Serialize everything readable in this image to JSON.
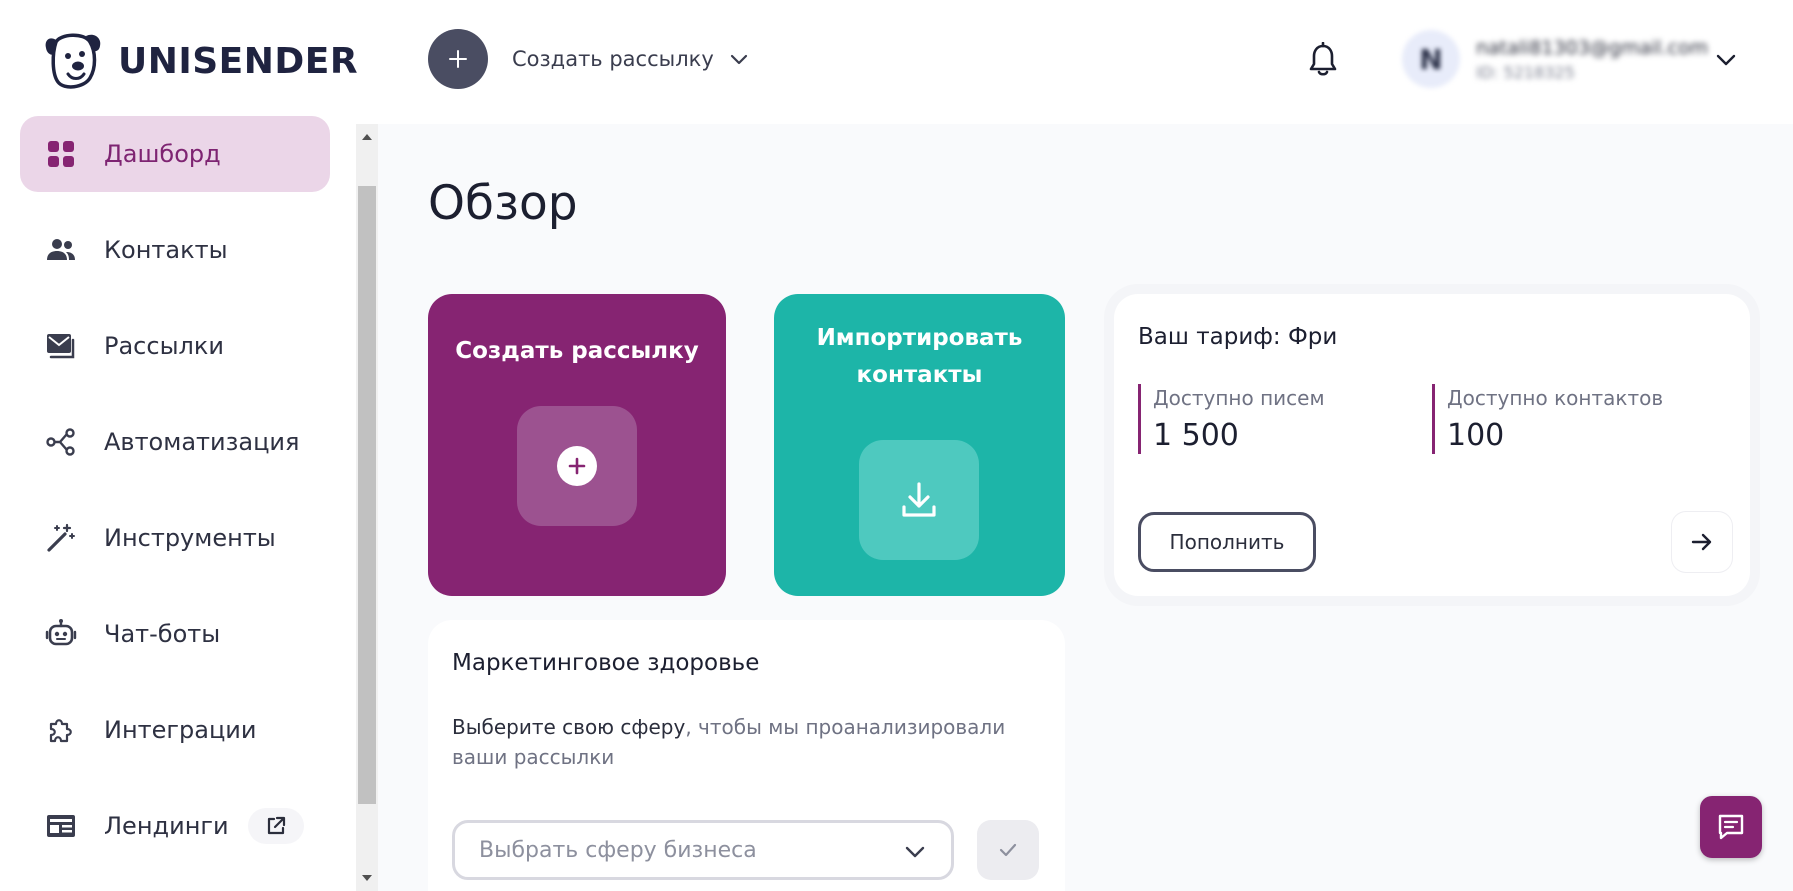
{
  "header": {
    "logo_text": "UNISENDER",
    "create_label": "Создать рассылку",
    "account": {
      "avatar_letter": "N",
      "email": "natali81303@gmail.com",
      "id": "ID: 5218325"
    }
  },
  "sidebar": {
    "items": [
      {
        "label": "Дашборд",
        "icon": "dashboard-icon",
        "active": true
      },
      {
        "label": "Контакты",
        "icon": "contacts-icon"
      },
      {
        "label": "Рассылки",
        "icon": "mail-icon"
      },
      {
        "label": "Автоматизация",
        "icon": "automation-icon"
      },
      {
        "label": "Инструменты",
        "icon": "magic-wand-icon"
      },
      {
        "label": "Чат-боты",
        "icon": "robot-icon"
      },
      {
        "label": "Интеграции",
        "icon": "puzzle-icon"
      },
      {
        "label": "Лендинги",
        "icon": "landing-icon",
        "external": true
      }
    ]
  },
  "main": {
    "title": "Обзор",
    "create_card": {
      "title": "Создать рассылку"
    },
    "import_card": {
      "title": "Импортировать контакты"
    },
    "tariff": {
      "title": "Ваш тариф: Фри",
      "letters_label": "Доступно писем",
      "letters_value": "1 500",
      "contacts_label": "Доступно контактов",
      "contacts_value": "100",
      "topup_label": "Пополнить"
    },
    "health": {
      "title": "Маркетинговое здоровье",
      "desc_link": "Выберите свою сферу",
      "desc_rest": ", чтобы мы проанализировали ваши рассылки",
      "select_placeholder": "Выбрать сферу бизнеса"
    }
  },
  "colors": {
    "brand_purple": "#862472",
    "brand_teal": "#1db5a8",
    "active_bg": "#ebd6e8",
    "dark_button": "#4a4d62"
  }
}
